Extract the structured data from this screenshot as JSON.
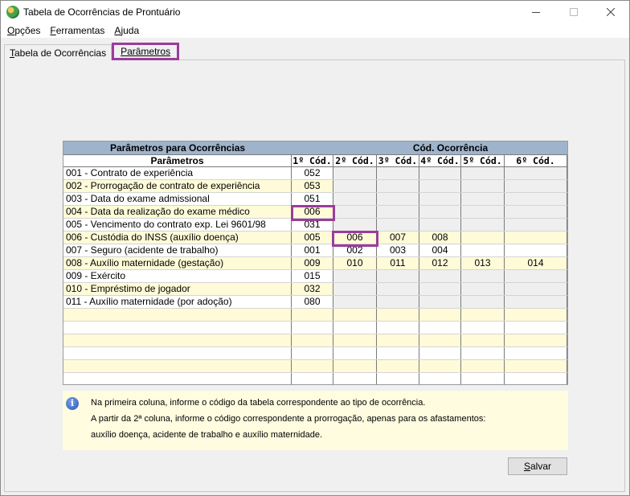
{
  "window": {
    "title": "Tabela de Ocorrências de Prontuário"
  },
  "menu": [
    {
      "first": "O",
      "rest": "pções"
    },
    {
      "first": "F",
      "rest": "erramentas"
    },
    {
      "first": "A",
      "rest": "juda"
    }
  ],
  "tabs": [
    {
      "first": "T",
      "rest": "abela de Ocorrências"
    },
    {
      "first": "",
      "rest": "Parâmetros"
    }
  ],
  "grid": {
    "header_left": "Parâmetros para Ocorrências",
    "header_right": "Cód. Ocorrência",
    "columns": [
      "Parâmetros",
      "1º Cód.",
      "2º Cód.",
      "3º Cód.",
      "4º Cód.",
      "5º Cód.",
      "6º Cód."
    ],
    "rows": [
      [
        "001 - Contrato de experiência",
        "052",
        "",
        "",
        "",
        "",
        ""
      ],
      [
        "002 - Prorrogação de contrato de experiência",
        "053",
        "",
        "",
        "",
        "",
        ""
      ],
      [
        "003 - Data do exame admissional",
        "051",
        "",
        "",
        "",
        "",
        ""
      ],
      [
        "004 - Data da realização do exame médico",
        "006",
        "",
        "",
        "",
        "",
        ""
      ],
      [
        "005 - Vencimento do contrato exp. Lei 9601/98",
        "031",
        "",
        "",
        "",
        "",
        ""
      ],
      [
        "006 - Custódia do INSS (auxílio doença)",
        "005",
        "006",
        "007",
        "008",
        "",
        ""
      ],
      [
        "007 - Seguro (acidente de trabalho)",
        "001",
        "002",
        "003",
        "004",
        "",
        ""
      ],
      [
        "008 - Auxílio maternidade (gestação)",
        "009",
        "010",
        "011",
        "012",
        "013",
        "014"
      ],
      [
        "009 - Exército",
        "015",
        "",
        "",
        "",
        "",
        ""
      ],
      [
        "010 - Empréstimo de jogador",
        "032",
        "",
        "",
        "",
        "",
        ""
      ],
      [
        "011 - Auxílio maternidade (por adoção)",
        "080",
        "",
        "",
        "",
        "",
        ""
      ],
      [
        "",
        "",
        "",
        "",
        "",
        "",
        ""
      ],
      [
        "",
        "",
        "",
        "",
        "",
        "",
        ""
      ],
      [
        "",
        "",
        "",
        "",
        "",
        "",
        ""
      ],
      [
        "",
        "",
        "",
        "",
        "",
        "",
        ""
      ],
      [
        "",
        "",
        "",
        "",
        "",
        "",
        ""
      ],
      [
        "",
        "",
        "",
        "",
        "",
        "",
        ""
      ]
    ]
  },
  "info": {
    "line1": "Na primeira coluna, informe o código da tabela correspondente ao tipo de ocorrência.",
    "line2": "A partir da 2ª coluna, informe o código correspondente a prorrogação, apenas para os afastamentos:",
    "line3": "auxílio doença, acidente de trabalho e auxílio maternidade."
  },
  "save_button": {
    "first": "S",
    "rest": "alvar"
  },
  "colors": {
    "highlight": "#9b3c9b",
    "header": "#9fb4cc",
    "row_alt": "#fffbd8"
  }
}
